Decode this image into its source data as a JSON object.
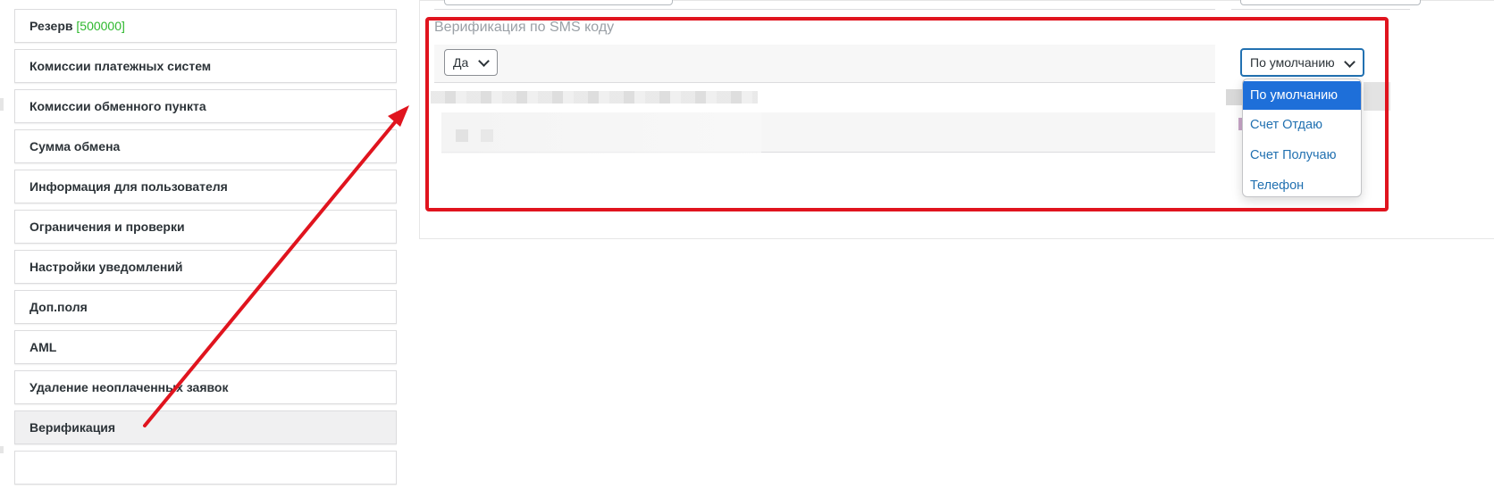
{
  "sidebar": {
    "reserve_label": "Резерв",
    "reserve_value": "[500000]",
    "items": [
      {
        "label": "Комиссии платежных систем"
      },
      {
        "label": "Комиссии обменного пункта"
      },
      {
        "label": "Сумма обмена"
      },
      {
        "label": "Информация для пользователя"
      },
      {
        "label": "Ограничения и проверки"
      },
      {
        "label": "Настройки уведомлений"
      },
      {
        "label": "Доп.поля"
      },
      {
        "label": "AML"
      },
      {
        "label": "Удаление неоплаченных заявок"
      },
      {
        "label": "Верификация"
      }
    ]
  },
  "main": {
    "section_title": "Верификация по SMS коду",
    "yes_select_value": "Да",
    "default_select_value": "По умолчанию",
    "dropdown_options": [
      {
        "label": "По умолчанию",
        "selected": true
      },
      {
        "label": "Счет Отдаю",
        "selected": false
      },
      {
        "label": "Счет Получаю",
        "selected": false
      },
      {
        "label": "Телефон",
        "selected": false
      }
    ]
  },
  "colors": {
    "annotation_red": "#e0141e",
    "selected_option": "#1e6fd9",
    "reserve_green": "#2eb82e"
  }
}
